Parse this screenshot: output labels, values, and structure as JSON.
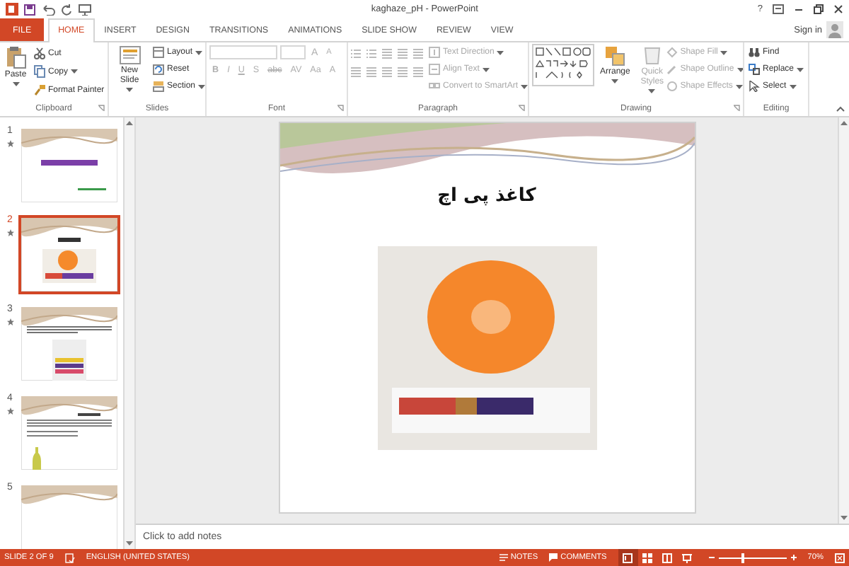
{
  "title_bar": {
    "title": "kaghaze_pH - PowerPoint",
    "help": "?"
  },
  "tabs": [
    {
      "label": "FILE",
      "kind": "file",
      "selected": false
    },
    {
      "label": "HOME",
      "kind": "tab",
      "selected": true
    },
    {
      "label": "INSERT",
      "kind": "tab",
      "selected": false
    },
    {
      "label": "DESIGN",
      "kind": "tab",
      "selected": false
    },
    {
      "label": "TRANSITIONS",
      "kind": "tab",
      "selected": false
    },
    {
      "label": "ANIMATIONS",
      "kind": "tab",
      "selected": false
    },
    {
      "label": "SLIDE SHOW",
      "kind": "tab",
      "selected": false
    },
    {
      "label": "REVIEW",
      "kind": "tab",
      "selected": false
    },
    {
      "label": "VIEW",
      "kind": "tab",
      "selected": false
    }
  ],
  "sign_in": "Sign in",
  "ribbon": {
    "groups": [
      {
        "label": "Clipboard",
        "launcher": true,
        "buttons": [
          {
            "label": "Paste",
            "kind": "large",
            "dropdown": true,
            "disabled": false
          },
          {
            "label": "Cut",
            "kind": "small",
            "dropdown": false,
            "disabled": false
          },
          {
            "label": "Copy",
            "kind": "small",
            "dropdown": true,
            "disabled": false
          },
          {
            "label": "Format Painter",
            "kind": "small",
            "dropdown": false,
            "disabled": false
          }
        ]
      },
      {
        "label": "Slides",
        "launcher": false,
        "buttons": [
          {
            "label": "New Slide",
            "kind": "large",
            "dropdown": true,
            "disabled": false
          },
          {
            "label": "Layout",
            "kind": "small",
            "dropdown": true,
            "disabled": false
          },
          {
            "label": "Reset",
            "kind": "small",
            "dropdown": false,
            "disabled": false
          },
          {
            "label": "Section",
            "kind": "small",
            "dropdown": true,
            "disabled": false
          }
        ]
      },
      {
        "label": "Font",
        "launcher": true,
        "tools_top": [
          {
            "label": "A",
            "disabled": true
          },
          {
            "label": "A",
            "disabled": true
          }
        ],
        "tools": [
          {
            "label": "B",
            "disabled": true
          },
          {
            "label": "I",
            "disabled": true
          },
          {
            "label": "U",
            "disabled": true
          },
          {
            "label": "S",
            "disabled": true
          },
          {
            "label": "abc",
            "disabled": true
          },
          {
            "label": "AV",
            "disabled": true
          },
          {
            "label": "Aa",
            "disabled": true
          },
          {
            "label": "A",
            "disabled": true
          }
        ]
      },
      {
        "label": "Paragraph",
        "launcher": true,
        "buttons": [
          {
            "label": "Text Direction",
            "kind": "small",
            "dropdown": true,
            "disabled": true
          },
          {
            "label": "Align Text",
            "kind": "small",
            "dropdown": true,
            "disabled": true
          },
          {
            "label": "Convert to SmartArt",
            "kind": "small",
            "dropdown": true,
            "disabled": true
          }
        ]
      },
      {
        "label": "Drawing",
        "launcher": true,
        "buttons": [
          {
            "label": "Arrange",
            "kind": "large",
            "dropdown": true,
            "disabled": false
          },
          {
            "label": "Quick Styles",
            "kind": "large",
            "dropdown": true,
            "disabled": true
          },
          {
            "label": "Shape Fill",
            "kind": "small",
            "dropdown": true,
            "disabled": true
          },
          {
            "label": "Shape Outline",
            "kind": "small",
            "dropdown": true,
            "disabled": true
          },
          {
            "label": "Shape Effects",
            "kind": "small",
            "dropdown": true,
            "disabled": true
          }
        ]
      },
      {
        "label": "Editing",
        "launcher": false,
        "buttons": [
          {
            "label": "Find",
            "kind": "small",
            "dropdown": false,
            "disabled": false
          },
          {
            "label": "Replace",
            "kind": "small",
            "dropdown": true,
            "disabled": false
          },
          {
            "label": "Select",
            "kind": "small",
            "dropdown": true,
            "disabled": false
          }
        ]
      }
    ]
  },
  "thumbnails": [
    {
      "number": "1",
      "kind": "title",
      "selected": false,
      "transition": true
    },
    {
      "number": "2",
      "kind": "photo",
      "selected": true,
      "transition": true
    },
    {
      "number": "3",
      "kind": "chart",
      "selected": false,
      "transition": true
    },
    {
      "number": "4",
      "kind": "bottle",
      "selected": false,
      "transition": true
    },
    {
      "number": "5",
      "kind": "blank",
      "selected": false,
      "transition": false
    }
  ],
  "slide": {
    "title": "کاغذ پی اچ"
  },
  "notes": {
    "placeholder": "Click to add notes"
  },
  "status_bar": {
    "slide_indicator": "SLIDE 2 OF 9",
    "language": "ENGLISH (UNITED STATES)",
    "notes": "NOTES",
    "comments": "COMMENTS",
    "views": [
      {
        "selected": true
      },
      {
        "selected": false
      },
      {
        "selected": false
      },
      {
        "selected": false
      }
    ],
    "zoom": {
      "level": 0.35,
      "reading": "70%"
    }
  }
}
